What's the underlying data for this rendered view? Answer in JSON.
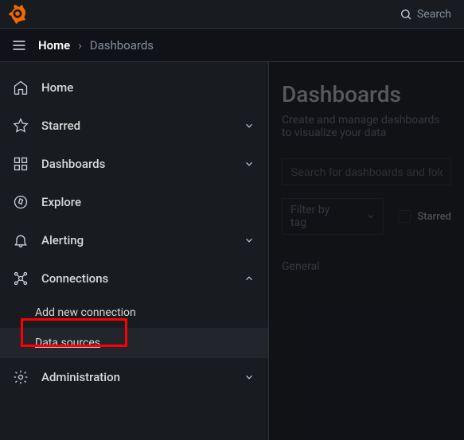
{
  "topbar": {
    "search_label": "Search"
  },
  "breadcrumb": {
    "root": "Home",
    "separator": "›",
    "current": "Dashboards"
  },
  "sidebar": {
    "items": [
      {
        "label": "Home"
      },
      {
        "label": "Starred"
      },
      {
        "label": "Dashboards"
      },
      {
        "label": "Explore"
      },
      {
        "label": "Alerting"
      },
      {
        "label": "Connections"
      },
      {
        "label": "Administration"
      }
    ],
    "connections_children": [
      {
        "label": "Add new connection"
      },
      {
        "label": "Data sources"
      }
    ]
  },
  "content": {
    "title": "Dashboards",
    "description": "Create and manage dashboards to visualize your data",
    "search_placeholder": "Search for dashboards and folders",
    "tag_filter": "Filter by tag",
    "starred_filter": "Starred",
    "folder_general": "General"
  }
}
